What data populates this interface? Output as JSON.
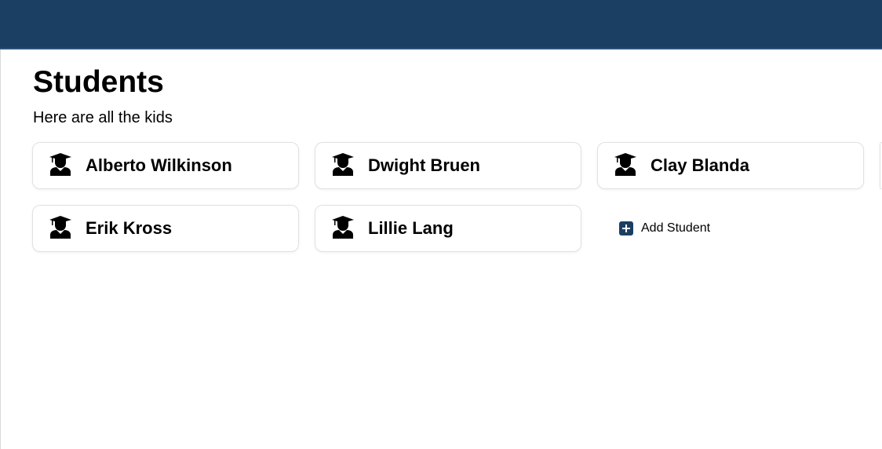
{
  "page": {
    "title": "Students",
    "subtitle": "Here are all the kids"
  },
  "students": [
    {
      "name": "Alberto Wilkinson",
      "icon": "graduate-icon"
    },
    {
      "name": "Dwight Bruen",
      "icon": "graduate-icon"
    },
    {
      "name": "Clay Blanda",
      "icon": "graduate-icon"
    },
    {
      "name": "Erik Kross",
      "icon": "graduate-icon"
    },
    {
      "name": "Lillie Lang",
      "icon": "graduate-icon"
    }
  ],
  "actions": {
    "add_student_label": "Add Student",
    "add_icon": "plus-square-icon"
  },
  "colors": {
    "header": "#1b3f62",
    "accent": "#1b3f62",
    "card_border": "#e1e1e1"
  }
}
